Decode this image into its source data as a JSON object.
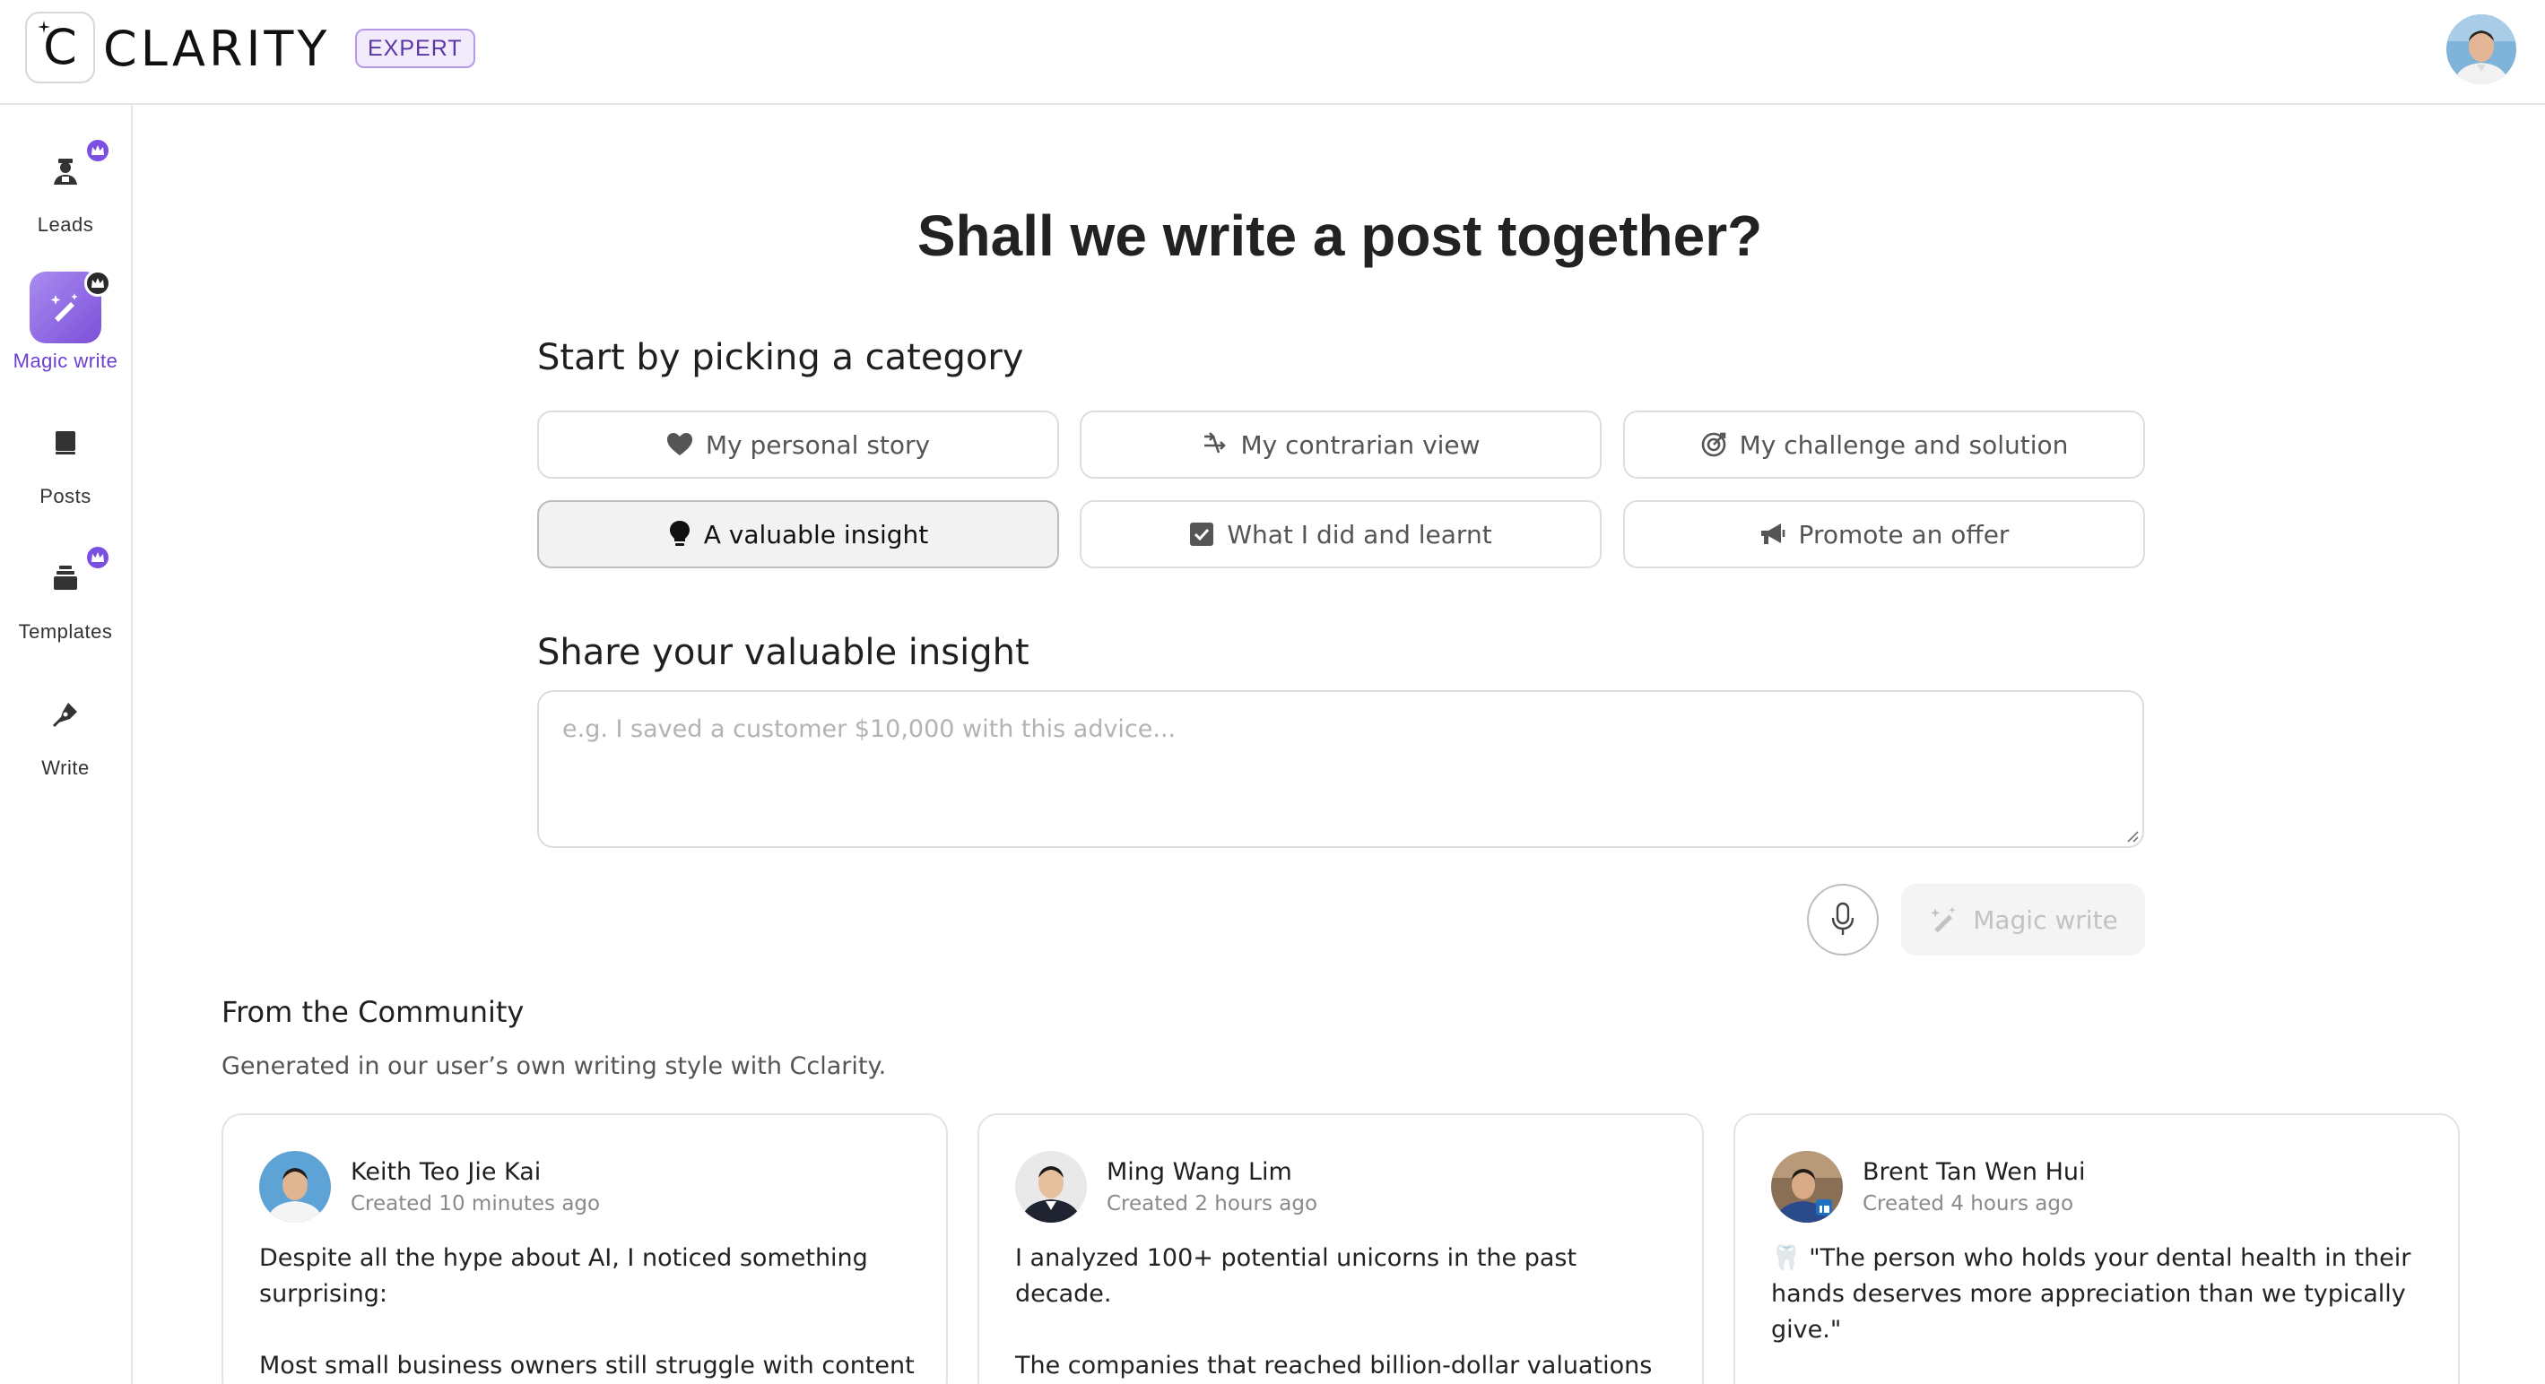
{
  "header": {
    "brand": "CLARITY",
    "badge": "EXPERT"
  },
  "sidebar": {
    "items": [
      {
        "label": "Leads",
        "icon": "leads-icon",
        "premium": true
      },
      {
        "label": "Magic write",
        "icon": "magic-wand-icon",
        "premium": true,
        "active": true
      },
      {
        "label": "Posts",
        "icon": "posts-icon",
        "premium": false
      },
      {
        "label": "Templates",
        "icon": "templates-icon",
        "premium": true
      },
      {
        "label": "Write",
        "icon": "pen-icon",
        "premium": false
      }
    ]
  },
  "main": {
    "title": "Shall we write a post together?",
    "category_heading": "Start by picking a category",
    "categories": [
      {
        "label": "My personal story",
        "icon": "heart-icon"
      },
      {
        "label": "My contrarian view",
        "icon": "contrarian-arrows-icon"
      },
      {
        "label": "My challenge and solution",
        "icon": "target-icon"
      },
      {
        "label": "A valuable insight",
        "icon": "lightbulb-icon",
        "selected": true
      },
      {
        "label": "What I did and learnt",
        "icon": "checkbox-icon"
      },
      {
        "label": "Promote an offer",
        "icon": "megaphone-icon"
      }
    ],
    "insight_heading": "Share your valuable insight",
    "insight_placeholder": "e.g. I saved a customer $10,000 with this advice...",
    "insight_value": "",
    "magic_write_label": "Magic write"
  },
  "community": {
    "title": "From the Community",
    "subtitle": "Generated in our user’s own writing style with Cclarity.",
    "cards": [
      {
        "name": "Keith Teo Jie Kai",
        "time": "Created 10 minutes ago",
        "body": "Despite all the hype about AI, I noticed something surprising:\n\nMost small business owners still struggle with content"
      },
      {
        "name": "Ming Wang Lim",
        "time": "Created 2 hours ago",
        "body": "I analyzed 100+ potential unicorns in the past decade.\n\nThe companies that reached billion-dollar valuations weren't the ones with the most innovative technology."
      },
      {
        "name": "Brent Tan Wen Hui",
        "time": "Created 4 hours ago",
        "body": "🦷 \"The person who holds your dental health in their hands deserves more appreciation than we typically give.\""
      }
    ]
  },
  "colors": {
    "accent": "#7b4fe0",
    "selected_bg": "#f2f2f2",
    "border": "#dedede"
  }
}
